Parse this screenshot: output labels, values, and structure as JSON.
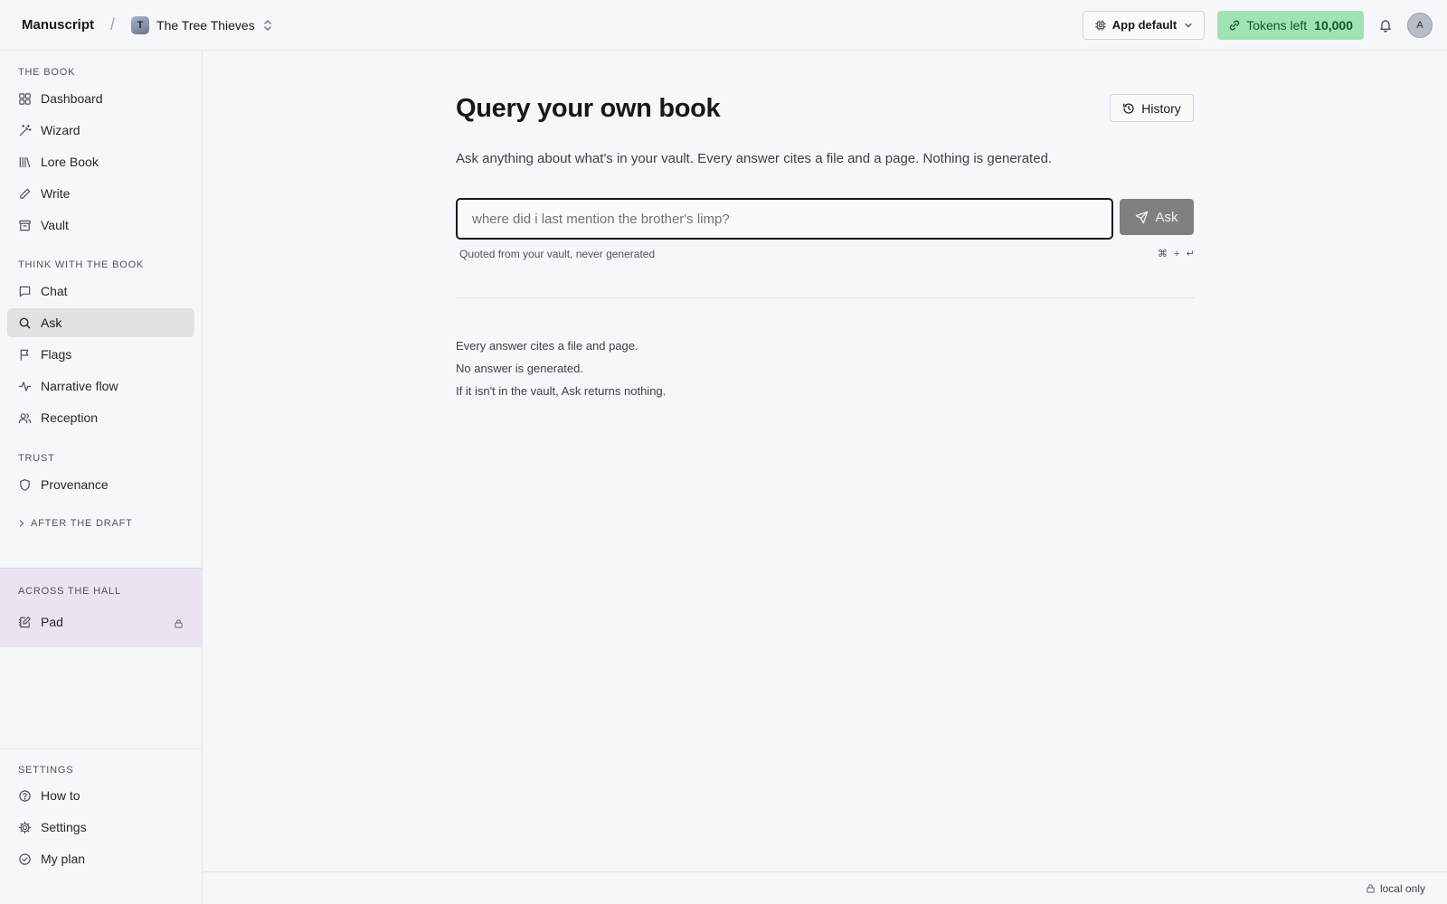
{
  "header": {
    "app_title": "Manuscript",
    "separator": "/",
    "project_initial": "T",
    "project_name": "The Tree Thieves",
    "model_select": "App default",
    "tokens_label": "Tokens left",
    "tokens_value": "10,000",
    "user_initial": "A"
  },
  "sidebar": {
    "sections": {
      "the_book": "THE BOOK",
      "think": "THINK WITH THE BOOK",
      "trust": "TRUST",
      "after_draft": "AFTER THE DRAFT",
      "across_hall": "ACROSS THE HALL",
      "settings": "SETTINGS"
    },
    "items": {
      "dashboard": "Dashboard",
      "wizard": "Wizard",
      "lore_book": "Lore Book",
      "write": "Write",
      "vault": "Vault",
      "chat": "Chat",
      "ask": "Ask",
      "flags": "Flags",
      "narrative_flow": "Narrative flow",
      "reception": "Reception",
      "provenance": "Provenance",
      "pad": "Pad",
      "how_to": "How to",
      "settings": "Settings",
      "my_plan": "My plan"
    },
    "active_item": "Ask"
  },
  "main": {
    "title": "Query your own book",
    "history_button": "History",
    "subtitle": "Ask anything about what's in your vault. Every answer cites a file and a page. Nothing is generated.",
    "input_placeholder": "where did i last mention the brother's limp?",
    "ask_button": "Ask",
    "hint": "Quoted from your vault, never generated",
    "shortcut": "⌘ + ↵",
    "notes": [
      "Every answer cites a file and page.",
      "No answer is generated.",
      "If it isn't in the vault, Ask returns nothing."
    ]
  },
  "footer": {
    "status": "local only"
  },
  "colors": {
    "background": "#f6f7fa",
    "tokens_badge": "#9fe3b2",
    "active_nav": "#e1e2e5",
    "across_hall_bg": "#ebe3f2",
    "ask_button": "#7f8084"
  }
}
